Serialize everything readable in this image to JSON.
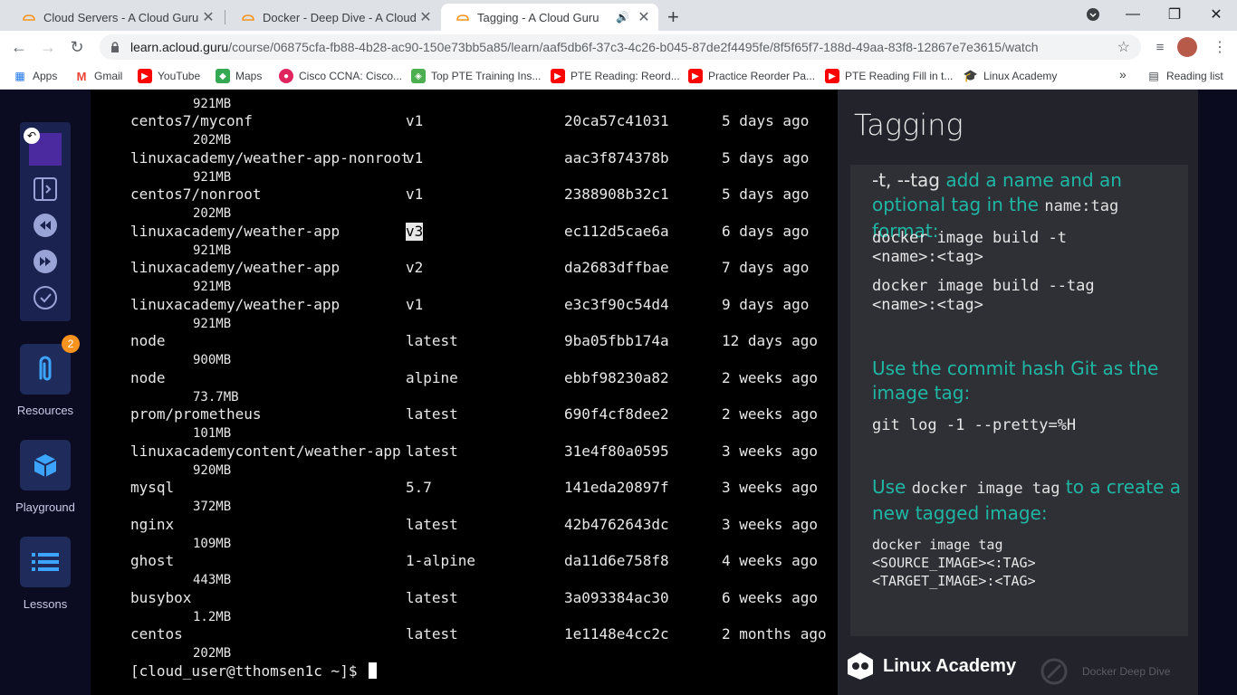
{
  "browser": {
    "tabs": [
      {
        "title": "Cloud Servers - A Cloud Guru",
        "active": false
      },
      {
        "title": "Docker - Deep Dive - A Cloud Gu",
        "active": false
      },
      {
        "title": "Tagging - A Cloud Guru",
        "active": true
      }
    ],
    "new_tab": "+",
    "url_host": "learn.acloud.guru",
    "url_path": "/course/06875cfa-fb88-4b28-ac90-150e73bb5a85/learn/aaf5db6f-37c3-4c26-b045-87de2f4495fe/8f5f65f7-188d-49aa-83f8-12867e7e3615/watch",
    "bookmarks": [
      {
        "label": "Apps",
        "icon": "apps-grid-icon",
        "color": "#1a73e8"
      },
      {
        "label": "Gmail",
        "icon": "gmail-icon",
        "color": "#ea4335"
      },
      {
        "label": "YouTube",
        "icon": "youtube-icon",
        "color": "#ff0000"
      },
      {
        "label": "Maps",
        "icon": "maps-icon",
        "color": "#34a853"
      },
      {
        "label": "Cisco CCNA: Cisco...",
        "icon": "cisco-icon",
        "color": "#e0245e"
      },
      {
        "label": "Top PTE Training Ins...",
        "icon": "shield-icon",
        "color": "#4caf50"
      },
      {
        "label": "PTE Reading: Reord...",
        "icon": "youtube-icon",
        "color": "#ff0000"
      },
      {
        "label": "Practice Reorder Pa...",
        "icon": "youtube-icon",
        "color": "#ff0000"
      },
      {
        "label": "PTE Reading Fill in t...",
        "icon": "youtube-icon",
        "color": "#ff0000"
      },
      {
        "label": "Linux Academy",
        "icon": "grad-cap-icon",
        "color": "#3c4043"
      }
    ],
    "more": "»",
    "reading_list": "Reading list"
  },
  "sidebar": {
    "resources_label": "Resources",
    "resources_badge": "2",
    "playground_label": "Playground",
    "lessons_label": "Lessons"
  },
  "terminal": {
    "top_size": "921MB",
    "rows": [
      {
        "repo": "centos7/myconf",
        "tag": "v1",
        "id": "20ca57c41031",
        "age": "5 days ago",
        "size": "202MB"
      },
      {
        "repo": "linuxacademy/weather-app-nonroot",
        "tag": "v1",
        "id": "aac3f874378b",
        "age": "5 days ago",
        "size": "921MB"
      },
      {
        "repo": "centos7/nonroot",
        "tag": "v1",
        "id": "2388908b32c1",
        "age": "5 days ago",
        "size": "202MB"
      },
      {
        "repo": "linuxacademy/weather-app",
        "tag": "v3",
        "id": "ec112d5cae6a",
        "age": "6 days ago",
        "size": "921MB"
      },
      {
        "repo": "linuxacademy/weather-app",
        "tag": "v2",
        "id": "da2683dffbae",
        "age": "7 days ago",
        "size": "921MB"
      },
      {
        "repo": "linuxacademy/weather-app",
        "tag": "v1",
        "id": "e3c3f90c54d4",
        "age": "9 days ago",
        "size": "921MB"
      },
      {
        "repo": "node",
        "tag": "latest",
        "id": "9ba05fbb174a",
        "age": "12 days ago",
        "size": "900MB"
      },
      {
        "repo": "node",
        "tag": "alpine",
        "id": "ebbf98230a82",
        "age": "2 weeks ago",
        "size": "73.7MB"
      },
      {
        "repo": "prom/prometheus",
        "tag": "latest",
        "id": "690f4cf8dee2",
        "age": "2 weeks ago",
        "size": "101MB"
      },
      {
        "repo": "linuxacademycontent/weather-app",
        "tag": "latest",
        "id": "31e4f80a0595",
        "age": "3 weeks ago",
        "size": "920MB"
      },
      {
        "repo": "mysql",
        "tag": "5.7",
        "id": "141eda20897f",
        "age": "3 weeks ago",
        "size": "372MB"
      },
      {
        "repo": "nginx",
        "tag": "latest",
        "id": "42b4762643dc",
        "age": "3 weeks ago",
        "size": "109MB"
      },
      {
        "repo": "ghost",
        "tag": "1-alpine",
        "id": "da11d6e758f8",
        "age": "4 weeks ago",
        "size": "443MB"
      },
      {
        "repo": "busybox",
        "tag": "latest",
        "id": "3a093384ac30",
        "age": "6 weeks ago",
        "size": "1.2MB"
      },
      {
        "repo": "centos",
        "tag": "latest",
        "id": "1e1148e4cc2c",
        "age": "2 months ago",
        "size": "202MB"
      }
    ],
    "prompt": "[cloud_user@tthomsen1c ~]$"
  },
  "slide": {
    "title": "Tagging",
    "p1_opt": "-t, --tag",
    "p1_rest": " add a name and an optional tag in the ",
    "p1_mono": "name:tag",
    "p1_end": " format:",
    "code1": "docker image build -t\n<name>:<tag>",
    "code2": "docker image build --tag\n<name>:<tag>",
    "p2": "Use the commit hash Git as the image tag:",
    "code3": "git log -1 --pretty=%H",
    "p3_a": "Use ",
    "p3_mono": "docker image tag",
    "p3_b": " to a create a new tagged image:",
    "code4": "docker image tag\n<SOURCE_IMAGE><:TAG>\n<TARGET_IMAGE>:<TAG>",
    "brand": "Linux Academy",
    "course": "Docker Deep Dive"
  },
  "colors": {
    "accent": "#1fb7a4",
    "sidebar_btn": "#1f2b5a",
    "badge": "#f7931e"
  }
}
